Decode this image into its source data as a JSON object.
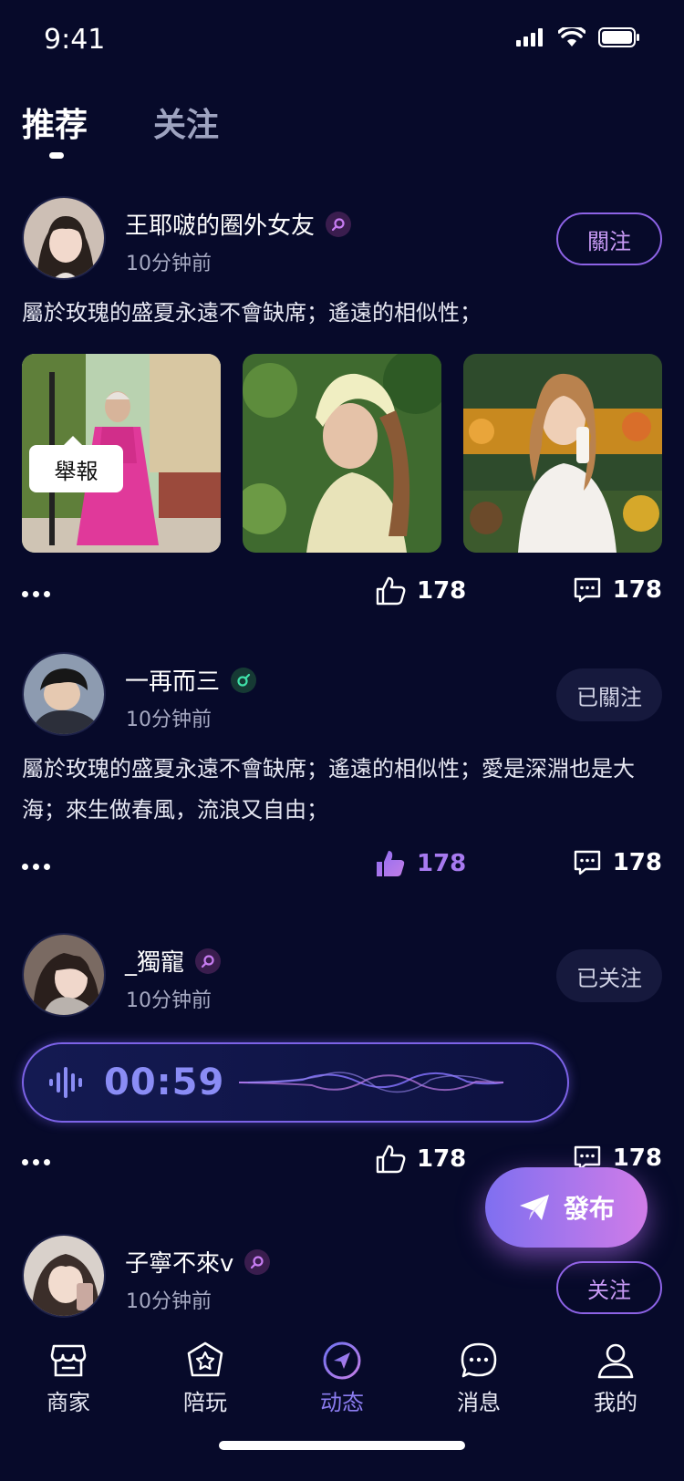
{
  "status": {
    "time": "9:41"
  },
  "tabs": [
    {
      "label": "推荐",
      "active": true
    },
    {
      "label": "关注",
      "active": false
    }
  ],
  "posts": [
    {
      "username": "王耶啵的圈外女友",
      "gender": "female",
      "time": "10分钟前",
      "follow_label": "關注",
      "text": "屬於玫瑰的盛夏永遠不會缺席；遙遠的相似性；",
      "likes": "178",
      "comments": "178"
    },
    {
      "username": "一再而三",
      "gender": "male",
      "time": "10分钟前",
      "follow_label": "已關注",
      "text": "屬於玫瑰的盛夏永遠不會缺席；遙遠的相似性；愛是深淵也是大海；來生做春風，流浪又自由；",
      "likes": "178",
      "comments": "178"
    },
    {
      "username": "_獨寵",
      "gender": "female",
      "time": "10分钟前",
      "follow_label": "已关注",
      "voice_duration": "00:59",
      "likes": "178",
      "comments": "178"
    },
    {
      "username": "子寧不來v",
      "gender": "female",
      "time": "10分钟前",
      "follow_label": "关注"
    }
  ],
  "tooltip": {
    "label": "舉報"
  },
  "publish": {
    "label": "發布"
  },
  "nav": [
    {
      "label": "商家",
      "icon": "store-icon"
    },
    {
      "label": "陪玩",
      "icon": "badge-star-icon"
    },
    {
      "label": "动态",
      "icon": "compass-icon",
      "active": true
    },
    {
      "label": "消息",
      "icon": "message-icon"
    },
    {
      "label": "我的",
      "icon": "user-icon"
    }
  ],
  "colors": {
    "background": "#070a2a",
    "accent": "#8b7cf0",
    "follow_outline": "#8d63e6"
  }
}
